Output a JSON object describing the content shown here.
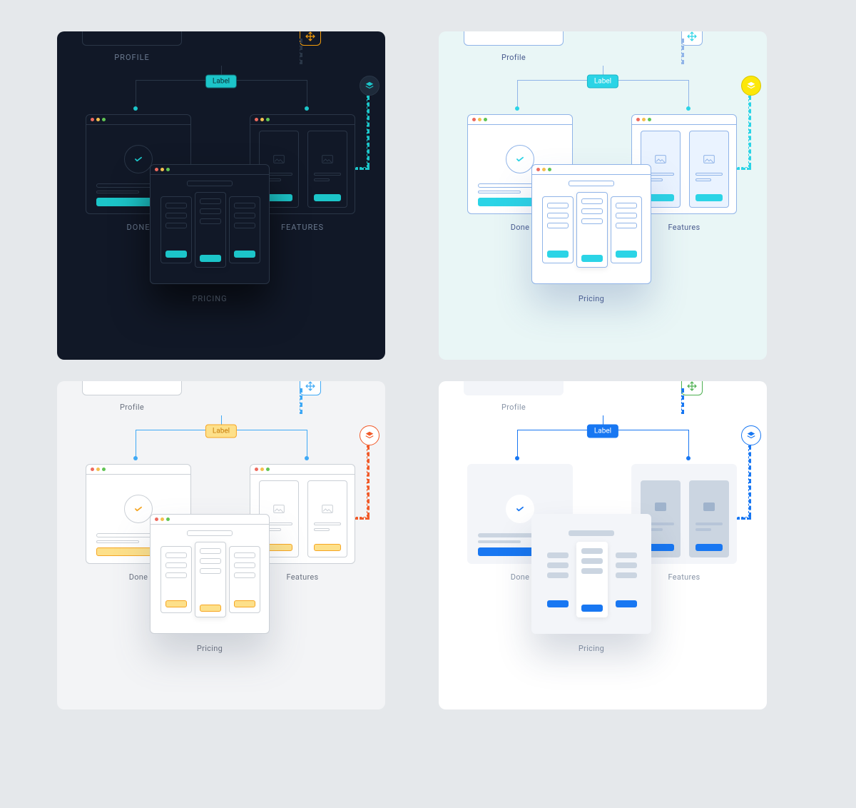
{
  "labels": {
    "profile": "Profile",
    "profile_upper": "PROFILE",
    "done": "Done",
    "done_upper": "DONE",
    "features": "Features",
    "features_upper": "FEATURES",
    "pricing": "Pricing",
    "pricing_upper": "PRICING",
    "label": "Label"
  },
  "themes": {
    "dark": {
      "bg": "#111827",
      "panel_stroke": "#2A3647",
      "panel_fill": "#111827",
      "text": "#6B7A90",
      "text_upper": true,
      "accent": "#1CC5C9",
      "accent_fill": "#1CC5C9",
      "tag_bg": "#1CC5C9",
      "tag_text": "#0B2F35",
      "tag_border": "#0E6B72",
      "connector": "#2A3647",
      "node": "#1CC5C9",
      "icon_bg": "#1E2A3A",
      "icon_stroke": "#2A3647",
      "icon_color": "#1CC5C9",
      "move_bg": "transparent",
      "move_border": "#F59E0B",
      "move_icon": "#F59E0B",
      "shadow": "0 30px 50px rgba(0,0,0,0.6)",
      "dashed_right": "#1CC5C9"
    },
    "teal": {
      "bg": "#E9F6F6",
      "panel_stroke": "#90B4E8",
      "panel_fill": "#FFFFFF",
      "text": "#4A5C8F",
      "text_upper": false,
      "accent": "#2BD4E6",
      "accent_fill": "#2BD4E6",
      "tag_bg": "#2BD4E6",
      "tag_text": "#FFFFFF",
      "tag_border": "#19B5C6",
      "connector": "#90B4E8",
      "node": "#2BD4E6",
      "icon_bg": "#FCE70A",
      "icon_stroke": "#D9C600",
      "icon_color": "#FFFFFF",
      "move_bg": "#FFFFFF",
      "move_border": "#90B4E8",
      "move_icon": "#2BD4E6",
      "shadow": "0 30px 50px rgba(70,100,160,0.25)",
      "dashed_right": "#2BD4E6"
    },
    "warm": {
      "bg": "#F3F4F6",
      "panel_stroke": "#CBD0D6",
      "panel_fill": "#FFFFFF",
      "text": "#6B7280",
      "text_upper": false,
      "accent": "#F6A623",
      "accent_fill": "#FDE08A",
      "tag_bg": "#FDE08A",
      "tag_text": "#C77D0A",
      "tag_border": "#F6A623",
      "connector": "#3FA9F5",
      "node": "#3FA9F5",
      "icon_bg": "#FFFFFF",
      "icon_stroke": "#F15A29",
      "icon_color": "#F15A29",
      "move_bg": "#FFFFFF",
      "move_border": "#3FA9F5",
      "move_icon": "#3FA9F5",
      "shadow": "0 30px 50px rgba(100,110,130,0.25)",
      "dashed_right": "#F15A29"
    },
    "blue": {
      "bg": "#FFFFFF",
      "panel_stroke": "none",
      "panel_fill": "#F3F5F9",
      "text": "#8A96A8",
      "text_upper": false,
      "accent": "#1877F2",
      "accent_fill": "#1877F2",
      "tag_bg": "#1877F2",
      "tag_text": "#FFFFFF",
      "tag_border": "#1877F2",
      "connector": "#1877F2",
      "node": "#1877F2",
      "icon_bg": "#FFFFFF",
      "icon_stroke": "#1877F2",
      "icon_color": "#1877F2",
      "move_bg": "transparent",
      "move_border": "#4CAF50",
      "move_icon": "#4CAF50",
      "shadow": "0 30px 50px rgba(30,50,90,0.18)",
      "dashed_right": "#1877F2",
      "secondary_fill": "#CBD5E1",
      "borderless": true
    }
  },
  "order": [
    "dark",
    "teal",
    "warm",
    "blue"
  ]
}
